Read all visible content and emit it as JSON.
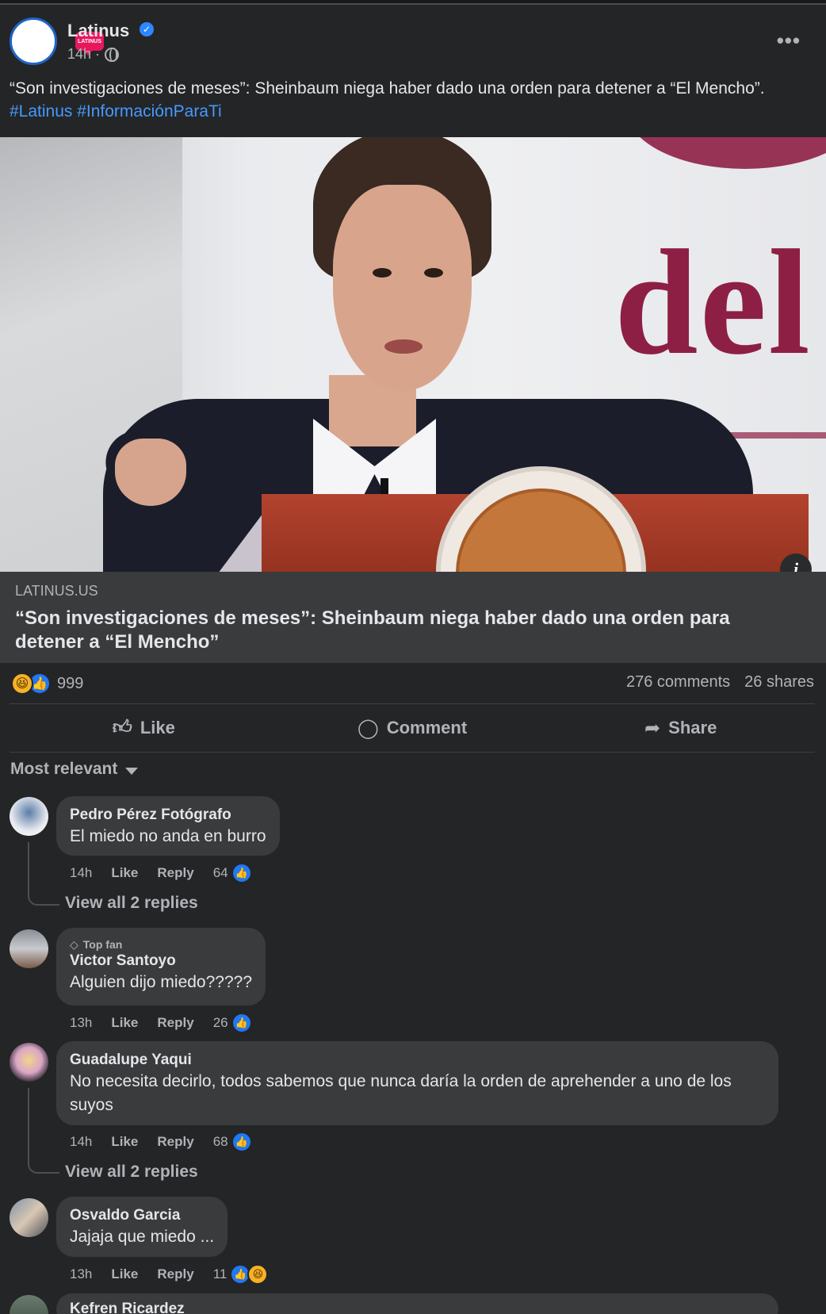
{
  "post": {
    "page_name": "Latinus",
    "avatar_text": "LATINUS",
    "time": "14h ·",
    "text": "“Son investigaciones de meses”: Sheinbaum niega haber dado una orden para detener a “El Mencho”.",
    "hashtags": "#Latinus #InformaciónParaTi",
    "more_label": "•••"
  },
  "link": {
    "domain": "LATINUS.US",
    "title": "“Son investigaciones de meses”: Sheinbaum niega haber dado una orden para detener a “El Mencho”"
  },
  "stats": {
    "reactions_count": "999",
    "comments": "276 comments",
    "shares": "26 shares"
  },
  "actions": {
    "like": "Like",
    "comment": "Comment",
    "share": "Share"
  },
  "sort_label": "Most relevant",
  "comments": [
    {
      "name": "Pedro Pérez Fotógrafo",
      "text": "El miedo no anda en burro",
      "time": "14h",
      "like": "Like",
      "reply": "Reply",
      "count": "64",
      "view_replies": "View all 2 replies"
    },
    {
      "badge": "Top fan",
      "name": "Victor Santoyo",
      "text": "Alguien dijo miedo?????",
      "time": "13h",
      "like": "Like",
      "reply": "Reply",
      "count": "26"
    },
    {
      "name": "Guadalupe Yaqui",
      "text": "No necesita decirlo, todos sabemos que nunca daría la orden de aprehender a uno de los suyos",
      "time": "14h",
      "like": "Like",
      "reply": "Reply",
      "count": "68",
      "view_replies": "View all 2 replies"
    },
    {
      "name": "Osvaldo Garcia",
      "text": "Jajaja que miedo ...",
      "time": "13h",
      "like": "Like",
      "reply": "Reply",
      "count": "11"
    },
    {
      "name": "Kefren Ricardez"
    }
  ],
  "colors": {
    "background": "#242526",
    "bubble": "#3a3b3c",
    "hashtag": "#4599ff",
    "like_blue": "#2078f4",
    "brand_pink": "#e8175d"
  }
}
